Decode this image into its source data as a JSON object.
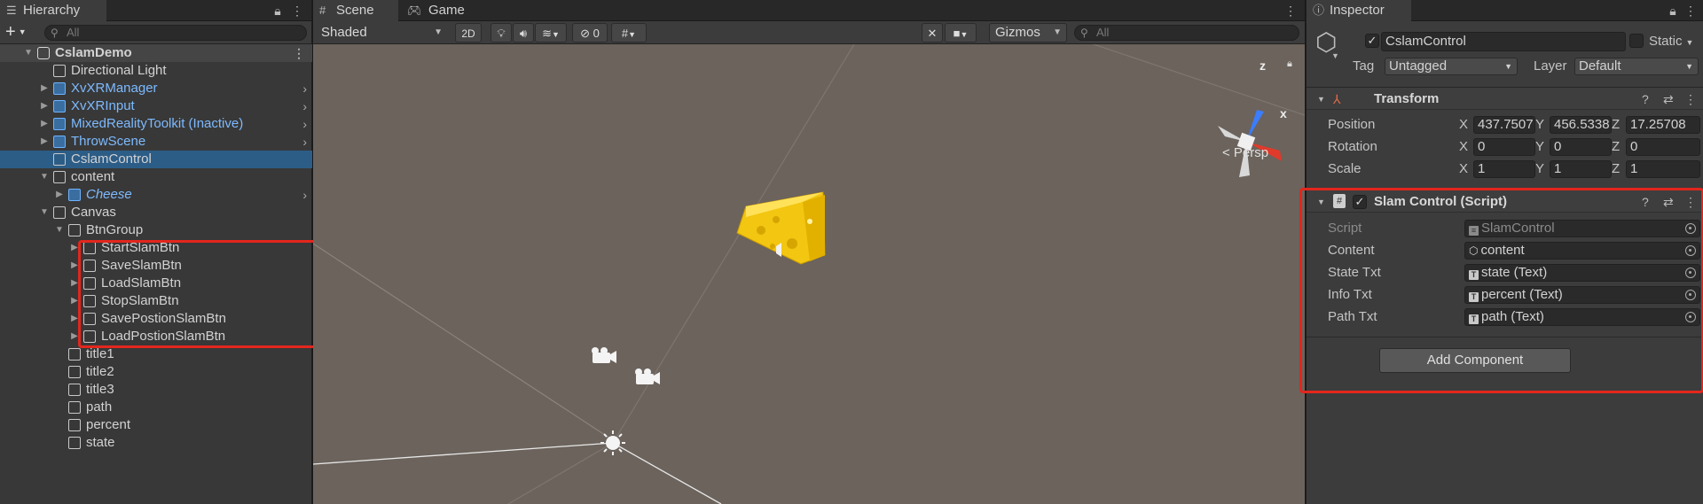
{
  "hierarchy": {
    "tab": "Hierarchy",
    "add_label": "+",
    "search_placeholder": "All",
    "rows": [
      {
        "label": "CslamDemo",
        "type": "scene",
        "depth": 0,
        "arrow": "▼"
      },
      {
        "label": "Directional Light",
        "type": "object",
        "depth": 1,
        "arrow": ""
      },
      {
        "label": "XvXRManager",
        "type": "prefab",
        "depth": 1,
        "arrow": "▶"
      },
      {
        "label": "XvXRInput",
        "type": "prefab",
        "depth": 1,
        "arrow": "▶"
      },
      {
        "label": "MixedRealityToolkit (Inactive)",
        "type": "prefab",
        "depth": 1,
        "arrow": "▶"
      },
      {
        "label": "ThrowScene",
        "type": "prefab",
        "depth": 1,
        "arrow": "▶"
      },
      {
        "label": "CslamControl",
        "type": "selected",
        "depth": 1,
        "arrow": ""
      },
      {
        "label": "content",
        "type": "object",
        "depth": 1,
        "arrow": "▼"
      },
      {
        "label": "Cheese",
        "type": "prefab-italic",
        "depth": 2,
        "arrow": "▶"
      },
      {
        "label": "Canvas",
        "type": "object",
        "depth": 1,
        "arrow": "▼"
      },
      {
        "label": "BtnGroup",
        "type": "object",
        "depth": 2,
        "arrow": "▼"
      },
      {
        "label": "StartSlamBtn",
        "type": "object",
        "depth": 3,
        "arrow": "▶"
      },
      {
        "label": "SaveSlamBtn",
        "type": "object",
        "depth": 3,
        "arrow": "▶"
      },
      {
        "label": "LoadSlamBtn",
        "type": "object",
        "depth": 3,
        "arrow": "▶"
      },
      {
        "label": "StopSlamBtn",
        "type": "object",
        "depth": 3,
        "arrow": "▶"
      },
      {
        "label": "SavePostionSlamBtn",
        "type": "object",
        "depth": 3,
        "arrow": "▶"
      },
      {
        "label": "LoadPostionSlamBtn",
        "type": "object",
        "depth": 3,
        "arrow": "▶"
      },
      {
        "label": "title1",
        "type": "object",
        "depth": 2,
        "arrow": ""
      },
      {
        "label": "title2",
        "type": "object",
        "depth": 2,
        "arrow": ""
      },
      {
        "label": "title3",
        "type": "object",
        "depth": 2,
        "arrow": ""
      },
      {
        "label": "path",
        "type": "object",
        "depth": 2,
        "arrow": ""
      },
      {
        "label": "percent",
        "type": "object",
        "depth": 2,
        "arrow": ""
      },
      {
        "label": "state",
        "type": "object",
        "depth": 2,
        "arrow": ""
      }
    ]
  },
  "scene": {
    "tab_scene": "Scene",
    "tab_game": "Game",
    "shading": "Shaded",
    "mode_2d": "2D",
    "hidden_count": "0",
    "gizmos": "Gizmos",
    "search_placeholder": "All",
    "persp": "< Persp",
    "axis_x": "x",
    "axis_z": "z"
  },
  "inspector": {
    "tab": "Inspector",
    "object_name": "CslamControl",
    "static_label": "Static",
    "tag_label": "Tag",
    "tag_value": "Untagged",
    "layer_label": "Layer",
    "layer_value": "Default",
    "transform": {
      "title": "Transform",
      "position_label": "Position",
      "rotation_label": "Rotation",
      "scale_label": "Scale",
      "position": [
        "437.7507",
        "456.5338",
        "17.25708"
      ],
      "rotation": [
        "0",
        "0",
        "0"
      ],
      "scale": [
        "1",
        "1",
        "1"
      ],
      "x": "X",
      "y": "Y",
      "z": "Z"
    },
    "script": {
      "title": "Slam Control (Script)",
      "script_label": "Script",
      "script_value": "SlamControl",
      "content_label": "Content",
      "content_value": "content",
      "state_label": "State Txt",
      "state_value": "state (Text)",
      "info_label": "Info Txt",
      "info_value": "percent (Text)",
      "path_label": "Path Txt",
      "path_value": "path (Text)"
    },
    "add_component": "Add Component"
  },
  "colors": {
    "selection": "#2c5d87",
    "highlight_box": "#e3261d",
    "prefab_text": "#7dbaff"
  }
}
